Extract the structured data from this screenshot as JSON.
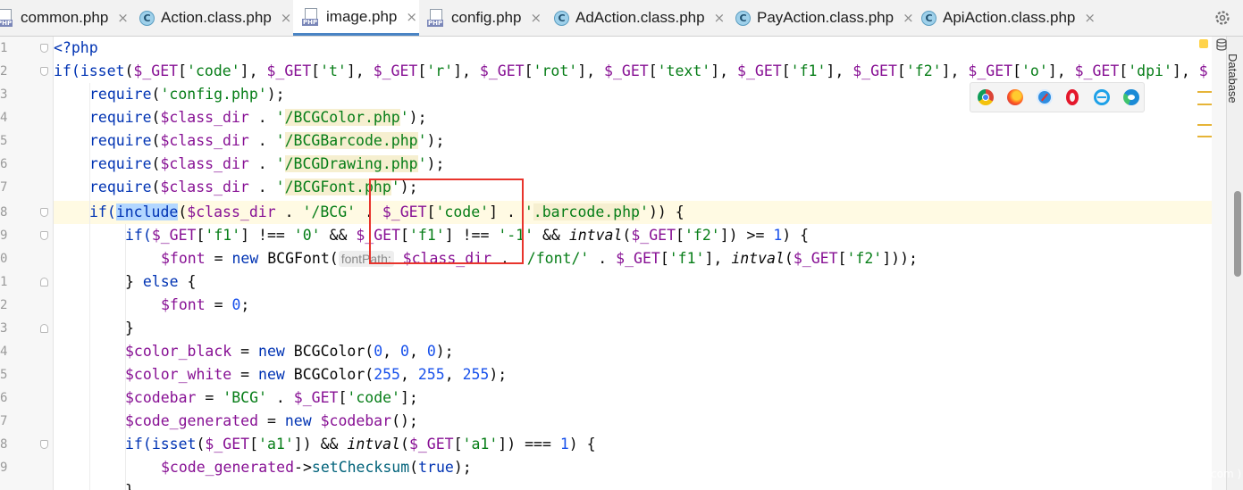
{
  "tabs": [
    {
      "label": "common.php",
      "icon": "php-file-icon"
    },
    {
      "label": "Action.class.php",
      "icon": "class-icon"
    },
    {
      "label": "image.php",
      "icon": "php-file-icon",
      "active": true
    },
    {
      "label": "config.php",
      "icon": "php-file-icon"
    },
    {
      "label": "AdAction.class.php",
      "icon": "class-icon"
    },
    {
      "label": "PayAction.class.php",
      "icon": "class-icon"
    },
    {
      "label": "ApiAction.class.php",
      "icon": "class-icon"
    }
  ],
  "tab_close_glyph": "×",
  "gutter": {
    "line_numbers": [
      "1",
      "2",
      "3",
      "4",
      "5",
      "6",
      "7",
      "8",
      "9",
      "0",
      "1",
      "2",
      "3",
      "4",
      "5",
      "6",
      "7",
      "8",
      "9"
    ]
  },
  "hint": {
    "font_path": "fontPath:"
  },
  "right_panel": {
    "database_label": "Database"
  },
  "watermark": "开发者 ( www.jimenwang.com )",
  "colors": {
    "accent": "#4a84c4",
    "keyword": "#0033b3",
    "string": "#067d17",
    "number": "#1750eb",
    "variable": "#871094",
    "highlight_box": "#e8342c"
  },
  "browser_icons": [
    "chrome-icon",
    "firefox-icon",
    "safari-icon",
    "opera-icon",
    "ie-icon",
    "edge-icon"
  ],
  "code": {
    "l1": {
      "a": "<?php"
    },
    "l2": {
      "a": "if(",
      "b": "isset",
      "c": "(",
      "d": "$_GET",
      "e": "[",
      "f": "'code'",
      "g": "], ",
      "h": "$_GET",
      "i": "[",
      "j": "'t'",
      "k": "], ",
      "l": "$_GET",
      "m": "[",
      "n": "'r'",
      "o": "], ",
      "p": "$_GET",
      "q": "[",
      "r": "'rot'",
      "s": "], ",
      "t": "$_GET",
      "u": "[",
      "v": "'text'",
      "w": "], ",
      "x": "$_GET",
      "y": "[",
      "z": "'f1'",
      "aa": "], ",
      "ab": "$_GET",
      "ac": "[",
      "ad": "'f2'",
      "ae": "], ",
      "af": "$_GET",
      "ag": "[",
      "ah": "'o'",
      "ai": "], ",
      "aj": "$_GET",
      "ak": "[",
      "al": "'dpi'",
      "am": "], ",
      "an": "$"
    },
    "l3": {
      "a": "require",
      "b": "(",
      "c": "'config.php'",
      "d": ");"
    },
    "l4": {
      "a": "require",
      "b": "(",
      "c": "$class_dir",
      "d": " . ",
      "e": "'",
      "f": "/BCGColor.php",
      "g": "'",
      "h": ");"
    },
    "l5": {
      "a": "require",
      "b": "(",
      "c": "$class_dir",
      "d": " . ",
      "e": "'",
      "f": "/BCGBarcode.php",
      "g": "'",
      "h": ");"
    },
    "l6": {
      "a": "require",
      "b": "(",
      "c": "$class_dir",
      "d": " . ",
      "e": "'",
      "f": "/BCGDrawing.php",
      "g": "'",
      "h": ");"
    },
    "l7": {
      "a": "require",
      "b": "(",
      "c": "$class_dir",
      "d": " . ",
      "e": "'",
      "f": "/BCGFont.php",
      "g": "'",
      "h": ");"
    },
    "l8": {
      "a": "if(",
      "b": "include",
      "c": "(",
      "d": "$class_dir",
      "e": " . ",
      "f": "'/BCG'",
      "g": " . ",
      "h": "$_GET",
      "i": "[",
      "j": "'code'",
      "k": "] . ",
      "l": "'",
      "m": ".barcode.php",
      "n": "'",
      "o": ")) {"
    },
    "l9": {
      "a": "if(",
      "b": "$_GET",
      "c": "[",
      "d": "'f1'",
      "e": "] !== ",
      "f": "'0'",
      "g": " && ",
      "h": "$_GET",
      "i": "[",
      "j": "'f1'",
      "k": "] !== ",
      "l": "'-1'",
      "m": " && ",
      "n": "intval",
      "o": "(",
      "p": "$_GET",
      "q": "[",
      "r": "'f2'",
      "s": "]) >= ",
      "t": "1",
      "u": ") {"
    },
    "l10": {
      "a": "$font",
      "b": " = ",
      "c": "new",
      "d": " BCGFont(",
      "e": " $class_dir",
      "f": " . ",
      "g": "'/font/'",
      "h": " . ",
      "i": "$_GET",
      "j": "[",
      "k": "'f1'",
      "l": "], ",
      "m": "intval",
      "n": "(",
      "o": "$_GET",
      "p": "[",
      "q": "'f2'",
      "r": "]));"
    },
    "l11": {
      "a": "} ",
      "b": "else",
      "c": " {"
    },
    "l12": {
      "a": "$font",
      "b": " = ",
      "c": "0",
      "d": ";"
    },
    "l13": {
      "a": "}"
    },
    "l14": {
      "a": "$color_black",
      "b": " = ",
      "c": "new",
      "d": " BCGColor(",
      "e": "0",
      "f": ", ",
      "g": "0",
      "h": ", ",
      "i": "0",
      "j": ");"
    },
    "l15": {
      "a": "$color_white",
      "b": " = ",
      "c": "new",
      "d": " BCGColor(",
      "e": "255",
      "f": ", ",
      "g": "255",
      "h": ", ",
      "i": "255",
      "j": ");"
    },
    "l16": {
      "a": "$codebar",
      "b": " = ",
      "c": "'BCG'",
      "d": " . ",
      "e": "$_GET",
      "f": "[",
      "g": "'code'",
      "h": "];"
    },
    "l17": {
      "a": "$code_generated",
      "b": " = ",
      "c": "new",
      "d": " ",
      "e": "$codebar",
      "f": "();"
    },
    "l18": {
      "a": "if(",
      "b": "isset",
      "c": "(",
      "d": "$_GET",
      "e": "[",
      "f": "'a1'",
      "g": "]) && ",
      "h": "intval",
      "i": "(",
      "j": "$_GET",
      "k": "[",
      "l": "'a1'",
      "m": "]) === ",
      "n": "1",
      "o": ") {"
    },
    "l19": {
      "a": "$code_generated",
      "b": "->",
      "c": "setChecksum",
      "d": "(",
      "e": "true",
      "f": ");"
    },
    "l20": {
      "a": "}"
    }
  }
}
